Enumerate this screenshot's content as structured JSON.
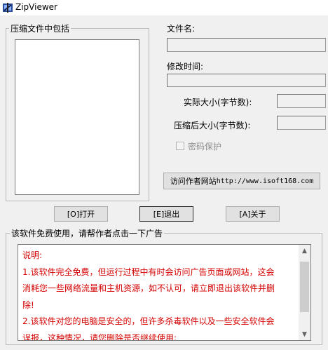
{
  "window": {
    "title": "ZipViewer",
    "icon": "zip-app-icon"
  },
  "archive_group": {
    "label": "压缩文件中包括"
  },
  "details": {
    "filename_label": "文件名:",
    "filename_value": "",
    "modified_label": "修改时间:",
    "modified_value": "",
    "actual_size_label": "实际大小(字节数):",
    "actual_size_value": "",
    "compressed_size_label": "压缩后大小(字节数):",
    "compressed_size_value": "",
    "password_label": "密码保护",
    "password_checked": false
  },
  "visit_button": {
    "label": "访问作者网站",
    "url": "http://www.isoft168.com"
  },
  "buttons": {
    "open": "[O]打开",
    "exit": "[E]退出",
    "about": "[A]关于"
  },
  "ad_group": {
    "label": "该软件免费使用，请帮作者点击一下广告",
    "lines": [
      "说明:",
      "1.该软件完全免费，但运行过程中有时会访问广告页面或网站，这会",
      "消耗您一些网络流量和主机资源，如不认可，请立即退出该软件并删",
      "除!",
      "2.该软件对您的电脑是安全的，但许多杀毒软件以及一些安全软件会",
      "误报，这种情况，请您删除是否继续使用:"
    ]
  },
  "colors": {
    "notice_text": "#d40000",
    "window_bg": "#f0f0f0"
  }
}
